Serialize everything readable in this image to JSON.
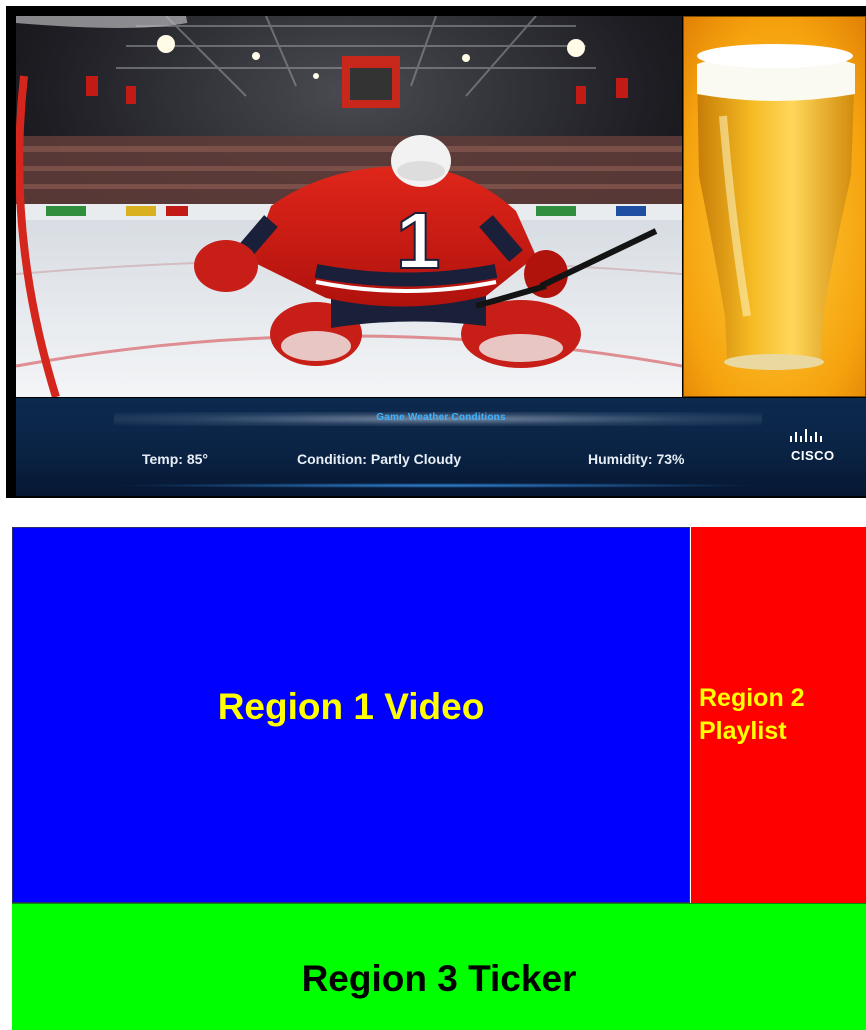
{
  "signage_screen": {
    "video_region": {
      "image": "hockey-goalie-arena-photo",
      "jersey_number": "1"
    },
    "playlist_region": {
      "image": "beer-glass-photo"
    },
    "ticker": {
      "title": "Game Weather Conditions",
      "items": [
        "Temp: 85°",
        "Condition: Partly Cloudy",
        "Humidity: 73%"
      ],
      "logo": "CISCO"
    }
  },
  "layout_diagram": {
    "region1": "Region 1 Video",
    "region2_line1": "Region 2",
    "region2_line2": "Playlist",
    "region3": "Region 3 Ticker"
  },
  "colors": {
    "region1": "#0000ff",
    "region2": "#ff0000",
    "region3": "#00ff00",
    "label_yellow": "#ffff00",
    "ticker_bg": "#0a2344",
    "ticker_title": "#3db3ff"
  }
}
